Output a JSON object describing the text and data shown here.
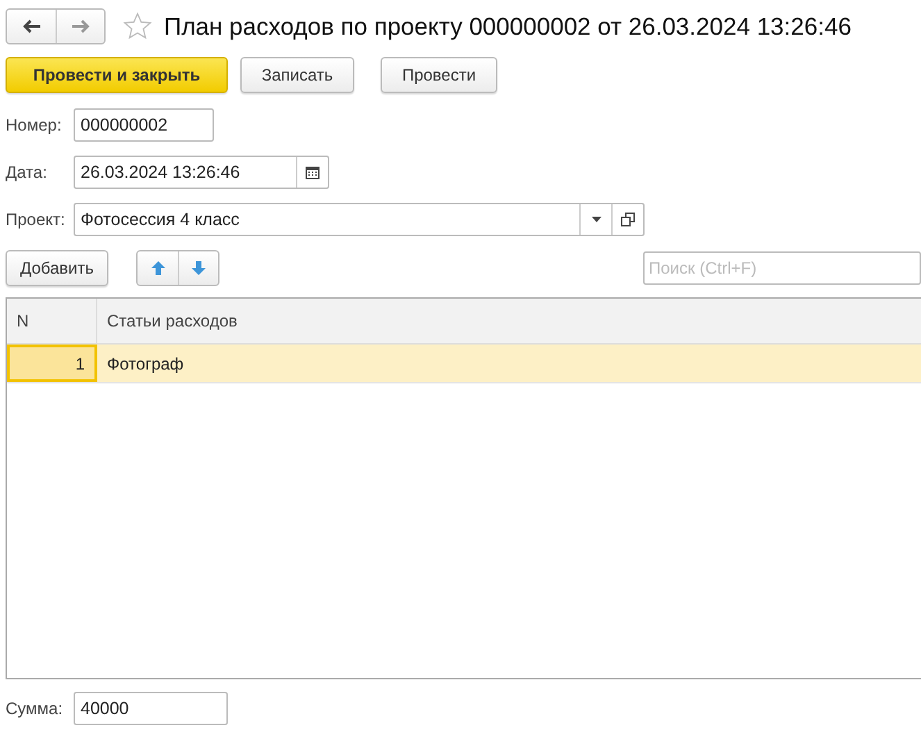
{
  "window": {
    "title": "План расходов по проекту 000000002 от 26.03.2024 13:26:46"
  },
  "buttons": [
    {
      "label": "Провести и закрыть",
      "kind": "primary"
    },
    {
      "label": "Записать",
      "kind": "default"
    },
    {
      "label": "Провести",
      "kind": "default"
    }
  ],
  "number": {
    "label": "Номер:",
    "value": "000000002"
  },
  "date": {
    "label": "Дата:",
    "value": "26.03.2024 13:26:46"
  },
  "project": {
    "label": "Проект:",
    "value": "Фотосессия 4 класс"
  },
  "table_toolbar": {
    "add_button": "Добавить",
    "search": {
      "placeholder": "Поиск (Ctrl+F)"
    }
  },
  "table": {
    "columns": [
      "N",
      "Статьи расходов"
    ],
    "rows": [
      {
        "n": "1",
        "item": "Фотограф",
        "selected": true
      }
    ]
  },
  "total": {
    "label": "Сумма:",
    "value": "40000"
  }
}
